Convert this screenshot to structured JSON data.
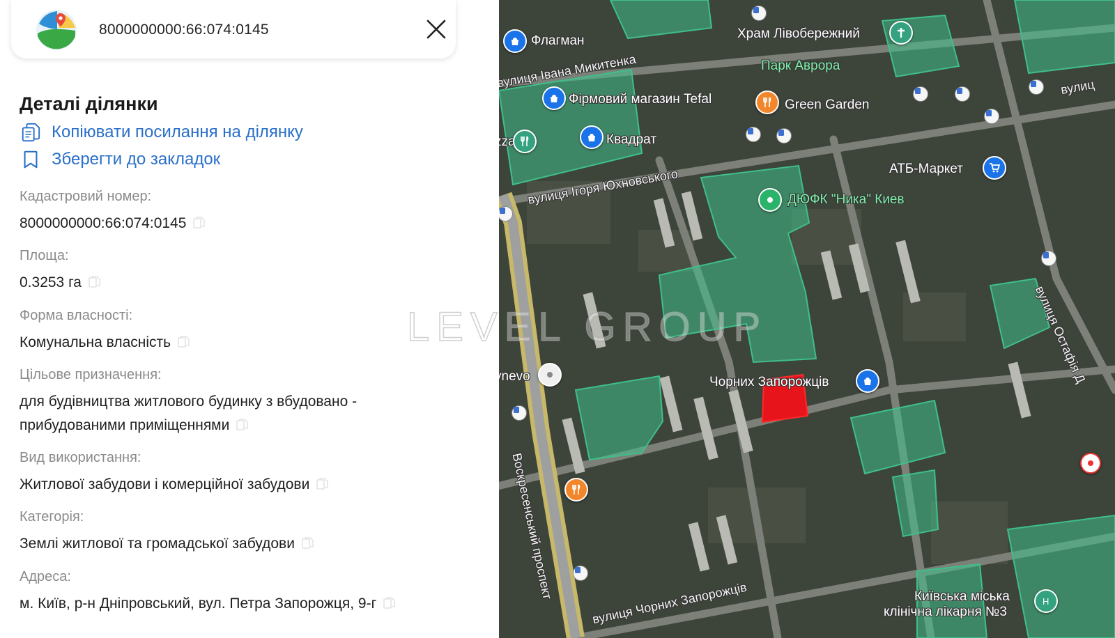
{
  "search": {
    "query": "8000000000:66:074:0145"
  },
  "details": {
    "title": "Деталі ділянки",
    "copy_link_label": "Копіювати посилання на ділянку",
    "bookmark_label": "Зберегти до закладок"
  },
  "fields": [
    {
      "label": "Кадастровий номер:",
      "value": "8000000000:66:074:0145"
    },
    {
      "label": "Площа:",
      "value": "0.3253 га"
    },
    {
      "label": "Форма власності:",
      "value": "Комунальна власність"
    },
    {
      "label": "Цільове призначення:",
      "value_line1": "для будівництва житлового будинку з вбудовано -",
      "value_line2": "прибудованими приміщеннями"
    },
    {
      "label": "Вид використання:",
      "value": "Житлової забудови і комерційної забудови"
    },
    {
      "label": "Категорія:",
      "value": "Землі житлової та громадської забудови"
    },
    {
      "label": "Адреса:",
      "value": "м. Київ, р-н Дніпровський, вул. Петра Запорожця, 9-г"
    }
  ],
  "watermark": "LEVEL GROUP",
  "map": {
    "labels": {
      "flagman": "Флагман",
      "khram": "Храм Лівобережний",
      "park": "Парк Аврора",
      "tefal": "Фірмовий магазин Tefal",
      "green_garden": "Green Garden",
      "kvadrat": "Квадрат",
      "zza": "zza",
      "atb": "АТБ-Маркет",
      "dyufk": "ДЮФК \"Ника\" Киев",
      "chornykh": "Чорних Запорожців",
      "vulytsia_mykytenka": "вулиця Івана Микитенка",
      "vulytsia_yukhnovskoho": "вулиця Ігоря Юхновського",
      "vulytsia_chornykh": "вулиця Чорних Запорожців",
      "voskresenskyi": "Воскресенський проспект",
      "ostafia": "вулиця Остафія Д",
      "vulyts_right": "вулиц",
      "lishchenevo": "ynevo",
      "hospital_line1": "Київська міська",
      "hospital_line2": "клінічна лікарня №3"
    },
    "colors": {
      "parcel_highlight": "#e8141c",
      "zone_fill": "#3fbf8a",
      "link_blue": "#2a6fc9"
    }
  }
}
